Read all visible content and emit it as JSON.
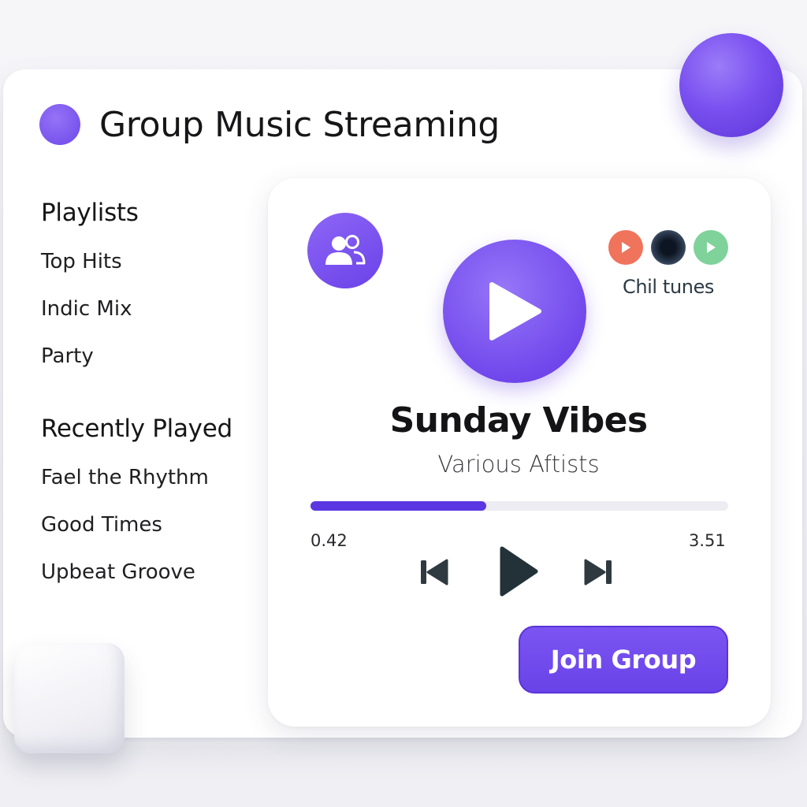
{
  "app": {
    "title": "Group Music Streaming",
    "accent_color": "#6d47ea"
  },
  "sidebar": {
    "playlists_title": "Playlists",
    "playlists": [
      "Top Hits",
      "Indic Mix",
      "Party"
    ],
    "recent_title": "Recently Played",
    "recent": [
      "Fael the Rhythm",
      "Good Times",
      "Upbeat Groove"
    ]
  },
  "player": {
    "group_icon": "users-icon",
    "big_play_icon": "play-icon",
    "mini_buttons": [
      {
        "icon": "play-icon",
        "color": "#f0735c"
      },
      {
        "icon": "avatar-dark",
        "color": "#0d1522"
      },
      {
        "icon": "play-icon",
        "color": "#7fd29a"
      }
    ],
    "mini_label": "Chil tunes",
    "track_title": "Sunday Vibes",
    "track_artist": "Various Aftists",
    "progress_fraction": 0.42,
    "elapsed": "0.42",
    "total": "3.51",
    "controls": [
      "skip-back-icon",
      "play-icon",
      "skip-forward-icon"
    ],
    "join_label": "Join Group"
  }
}
